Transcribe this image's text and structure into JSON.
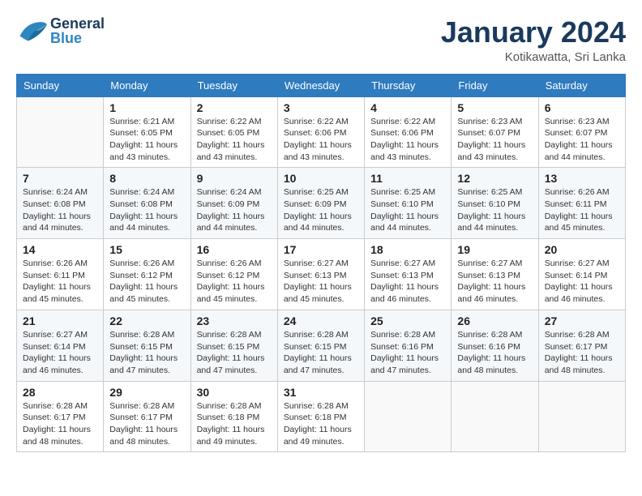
{
  "header": {
    "logo_general": "General",
    "logo_blue": "Blue",
    "month_title": "January 2024",
    "location": "Kotikawatta, Sri Lanka"
  },
  "calendar": {
    "days_of_week": [
      "Sunday",
      "Monday",
      "Tuesday",
      "Wednesday",
      "Thursday",
      "Friday",
      "Saturday"
    ],
    "weeks": [
      [
        {
          "day": "",
          "info": ""
        },
        {
          "day": "1",
          "info": "Sunrise: 6:21 AM\nSunset: 6:05 PM\nDaylight: 11 hours\nand 43 minutes."
        },
        {
          "day": "2",
          "info": "Sunrise: 6:22 AM\nSunset: 6:05 PM\nDaylight: 11 hours\nand 43 minutes."
        },
        {
          "day": "3",
          "info": "Sunrise: 6:22 AM\nSunset: 6:06 PM\nDaylight: 11 hours\nand 43 minutes."
        },
        {
          "day": "4",
          "info": "Sunrise: 6:22 AM\nSunset: 6:06 PM\nDaylight: 11 hours\nand 43 minutes."
        },
        {
          "day": "5",
          "info": "Sunrise: 6:23 AM\nSunset: 6:07 PM\nDaylight: 11 hours\nand 43 minutes."
        },
        {
          "day": "6",
          "info": "Sunrise: 6:23 AM\nSunset: 6:07 PM\nDaylight: 11 hours\nand 44 minutes."
        }
      ],
      [
        {
          "day": "7",
          "info": "Sunrise: 6:24 AM\nSunset: 6:08 PM\nDaylight: 11 hours\nand 44 minutes."
        },
        {
          "day": "8",
          "info": "Sunrise: 6:24 AM\nSunset: 6:08 PM\nDaylight: 11 hours\nand 44 minutes."
        },
        {
          "day": "9",
          "info": "Sunrise: 6:24 AM\nSunset: 6:09 PM\nDaylight: 11 hours\nand 44 minutes."
        },
        {
          "day": "10",
          "info": "Sunrise: 6:25 AM\nSunset: 6:09 PM\nDaylight: 11 hours\nand 44 minutes."
        },
        {
          "day": "11",
          "info": "Sunrise: 6:25 AM\nSunset: 6:10 PM\nDaylight: 11 hours\nand 44 minutes."
        },
        {
          "day": "12",
          "info": "Sunrise: 6:25 AM\nSunset: 6:10 PM\nDaylight: 11 hours\nand 44 minutes."
        },
        {
          "day": "13",
          "info": "Sunrise: 6:26 AM\nSunset: 6:11 PM\nDaylight: 11 hours\nand 45 minutes."
        }
      ],
      [
        {
          "day": "14",
          "info": "Sunrise: 6:26 AM\nSunset: 6:11 PM\nDaylight: 11 hours\nand 45 minutes."
        },
        {
          "day": "15",
          "info": "Sunrise: 6:26 AM\nSunset: 6:12 PM\nDaylight: 11 hours\nand 45 minutes."
        },
        {
          "day": "16",
          "info": "Sunrise: 6:26 AM\nSunset: 6:12 PM\nDaylight: 11 hours\nand 45 minutes."
        },
        {
          "day": "17",
          "info": "Sunrise: 6:27 AM\nSunset: 6:13 PM\nDaylight: 11 hours\nand 45 minutes."
        },
        {
          "day": "18",
          "info": "Sunrise: 6:27 AM\nSunset: 6:13 PM\nDaylight: 11 hours\nand 46 minutes."
        },
        {
          "day": "19",
          "info": "Sunrise: 6:27 AM\nSunset: 6:13 PM\nDaylight: 11 hours\nand 46 minutes."
        },
        {
          "day": "20",
          "info": "Sunrise: 6:27 AM\nSunset: 6:14 PM\nDaylight: 11 hours\nand 46 minutes."
        }
      ],
      [
        {
          "day": "21",
          "info": "Sunrise: 6:27 AM\nSunset: 6:14 PM\nDaylight: 11 hours\nand 46 minutes."
        },
        {
          "day": "22",
          "info": "Sunrise: 6:28 AM\nSunset: 6:15 PM\nDaylight: 11 hours\nand 47 minutes."
        },
        {
          "day": "23",
          "info": "Sunrise: 6:28 AM\nSunset: 6:15 PM\nDaylight: 11 hours\nand 47 minutes."
        },
        {
          "day": "24",
          "info": "Sunrise: 6:28 AM\nSunset: 6:15 PM\nDaylight: 11 hours\nand 47 minutes."
        },
        {
          "day": "25",
          "info": "Sunrise: 6:28 AM\nSunset: 6:16 PM\nDaylight: 11 hours\nand 47 minutes."
        },
        {
          "day": "26",
          "info": "Sunrise: 6:28 AM\nSunset: 6:16 PM\nDaylight: 11 hours\nand 48 minutes."
        },
        {
          "day": "27",
          "info": "Sunrise: 6:28 AM\nSunset: 6:17 PM\nDaylight: 11 hours\nand 48 minutes."
        }
      ],
      [
        {
          "day": "28",
          "info": "Sunrise: 6:28 AM\nSunset: 6:17 PM\nDaylight: 11 hours\nand 48 minutes."
        },
        {
          "day": "29",
          "info": "Sunrise: 6:28 AM\nSunset: 6:17 PM\nDaylight: 11 hours\nand 48 minutes."
        },
        {
          "day": "30",
          "info": "Sunrise: 6:28 AM\nSunset: 6:18 PM\nDaylight: 11 hours\nand 49 minutes."
        },
        {
          "day": "31",
          "info": "Sunrise: 6:28 AM\nSunset: 6:18 PM\nDaylight: 11 hours\nand 49 minutes."
        },
        {
          "day": "",
          "info": ""
        },
        {
          "day": "",
          "info": ""
        },
        {
          "day": "",
          "info": ""
        }
      ]
    ]
  }
}
